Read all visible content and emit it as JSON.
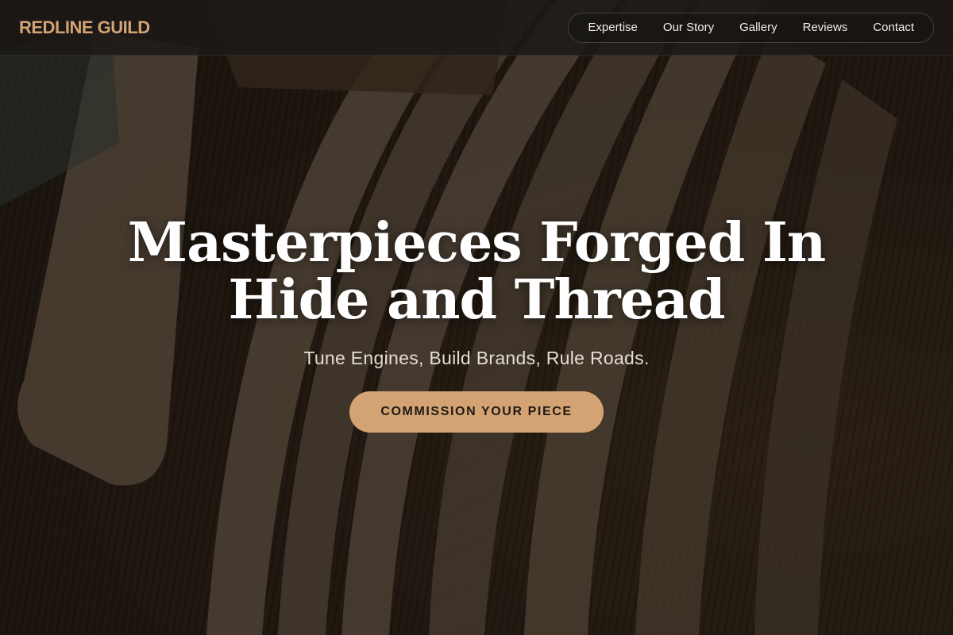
{
  "brand": {
    "name": "REDLINE GUILD",
    "accent_color": "#d4a373"
  },
  "nav": {
    "items": [
      {
        "label": "Expertise"
      },
      {
        "label": "Our Story"
      },
      {
        "label": "Gallery"
      },
      {
        "label": "Reviews"
      },
      {
        "label": "Contact"
      }
    ]
  },
  "hero": {
    "headline_line1": "Masterpieces Forged In",
    "headline_line2": "Hide and Thread",
    "subheadline": "Tune Engines, Build Brands, Rule Roads.",
    "cta_label": "COMMISSION YOUR PIECE",
    "background_image": "leather-strips-workbench-photo"
  }
}
